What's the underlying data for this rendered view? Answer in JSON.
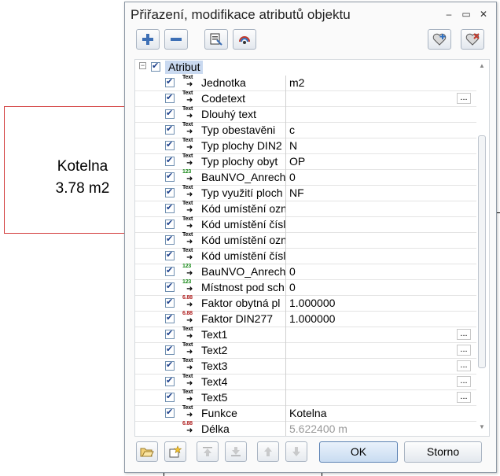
{
  "background": {
    "room_name": "Kotelna",
    "room_area": "3.78 m2"
  },
  "dialog": {
    "title": "Přiřazení, modifikace atributů objektu",
    "window_buttons": [
      "‒",
      "▭",
      "✕"
    ],
    "toolbar": {
      "icons": [
        "add-attribute-icon",
        "remove-attribute-icon",
        "select-template-icon",
        "load-settings-icon",
        "favorite-add-icon",
        "favorite-remove-icon"
      ]
    },
    "tree": {
      "root_label": "Atribut",
      "collapse_glyph": "−"
    },
    "rows": [
      {
        "type": "text",
        "label": "Jednotka",
        "value": "m2",
        "ellipsis": false,
        "checked": true
      },
      {
        "type": "text",
        "label": "Codetext",
        "value": "",
        "ellipsis": true,
        "checked": true
      },
      {
        "type": "text",
        "label": "Dlouhý text",
        "value": "",
        "ellipsis": false,
        "checked": true
      },
      {
        "type": "text",
        "label": "Typ obestavěni",
        "value": "c",
        "ellipsis": false,
        "checked": true
      },
      {
        "type": "text",
        "label": "Typ plochy DIN2",
        "value": "N",
        "ellipsis": false,
        "checked": true
      },
      {
        "type": "text",
        "label": "Typ plochy obyt",
        "value": "OP",
        "ellipsis": false,
        "checked": true
      },
      {
        "type": "int",
        "label": "BauNVO_Anrech",
        "value": "0",
        "ellipsis": false,
        "checked": true
      },
      {
        "type": "text",
        "label": "Typ využití ploch",
        "value": "NF",
        "ellipsis": false,
        "checked": true
      },
      {
        "type": "text",
        "label": "Kód umístění ozn",
        "value": "",
        "ellipsis": false,
        "checked": true
      },
      {
        "type": "text",
        "label": "Kód umístění čísl",
        "value": "",
        "ellipsis": false,
        "checked": true
      },
      {
        "type": "text",
        "label": "Kód umístění ozn",
        "value": "",
        "ellipsis": false,
        "checked": true
      },
      {
        "type": "text",
        "label": "Kód umístění čísl",
        "value": "",
        "ellipsis": false,
        "checked": true
      },
      {
        "type": "int",
        "label": "BauNVO_Anrech",
        "value": "0",
        "ellipsis": false,
        "checked": true
      },
      {
        "type": "int",
        "label": "Místnost pod sch",
        "value": "0",
        "ellipsis": false,
        "checked": true
      },
      {
        "type": "float",
        "label": "Faktor obytná pl",
        "value": "1.000000",
        "ellipsis": false,
        "checked": true
      },
      {
        "type": "float",
        "label": "Faktor DIN277",
        "value": "1.000000",
        "ellipsis": false,
        "checked": true
      },
      {
        "type": "text",
        "label": "Text1",
        "value": "",
        "ellipsis": true,
        "checked": true
      },
      {
        "type": "text",
        "label": "Text2",
        "value": "",
        "ellipsis": true,
        "checked": true
      },
      {
        "type": "text",
        "label": "Text3",
        "value": "",
        "ellipsis": true,
        "checked": true
      },
      {
        "type": "text",
        "label": "Text4",
        "value": "",
        "ellipsis": true,
        "checked": true
      },
      {
        "type": "text",
        "label": "Text5",
        "value": "",
        "ellipsis": true,
        "checked": true
      },
      {
        "type": "text",
        "label": "Funkce",
        "value": "Kotelna",
        "ellipsis": false,
        "checked": true
      },
      {
        "type": "float",
        "label": "Délka",
        "value": "5.622400 m",
        "ellipsis": false,
        "checked": false,
        "readonly": true
      }
    ],
    "type_icons": {
      "text": {
        "top": "Text",
        "color": "#000000"
      },
      "int": {
        "top": "123",
        "color": "#1a8a1a"
      },
      "float": {
        "top": "6.88",
        "color": "#b02020"
      }
    },
    "ellipsis_label": "...",
    "buttons": {
      "ok": "OK",
      "cancel": "Storno"
    },
    "colors": {
      "selection": "#c9d9f0",
      "accent": "#1b3f8a"
    }
  }
}
